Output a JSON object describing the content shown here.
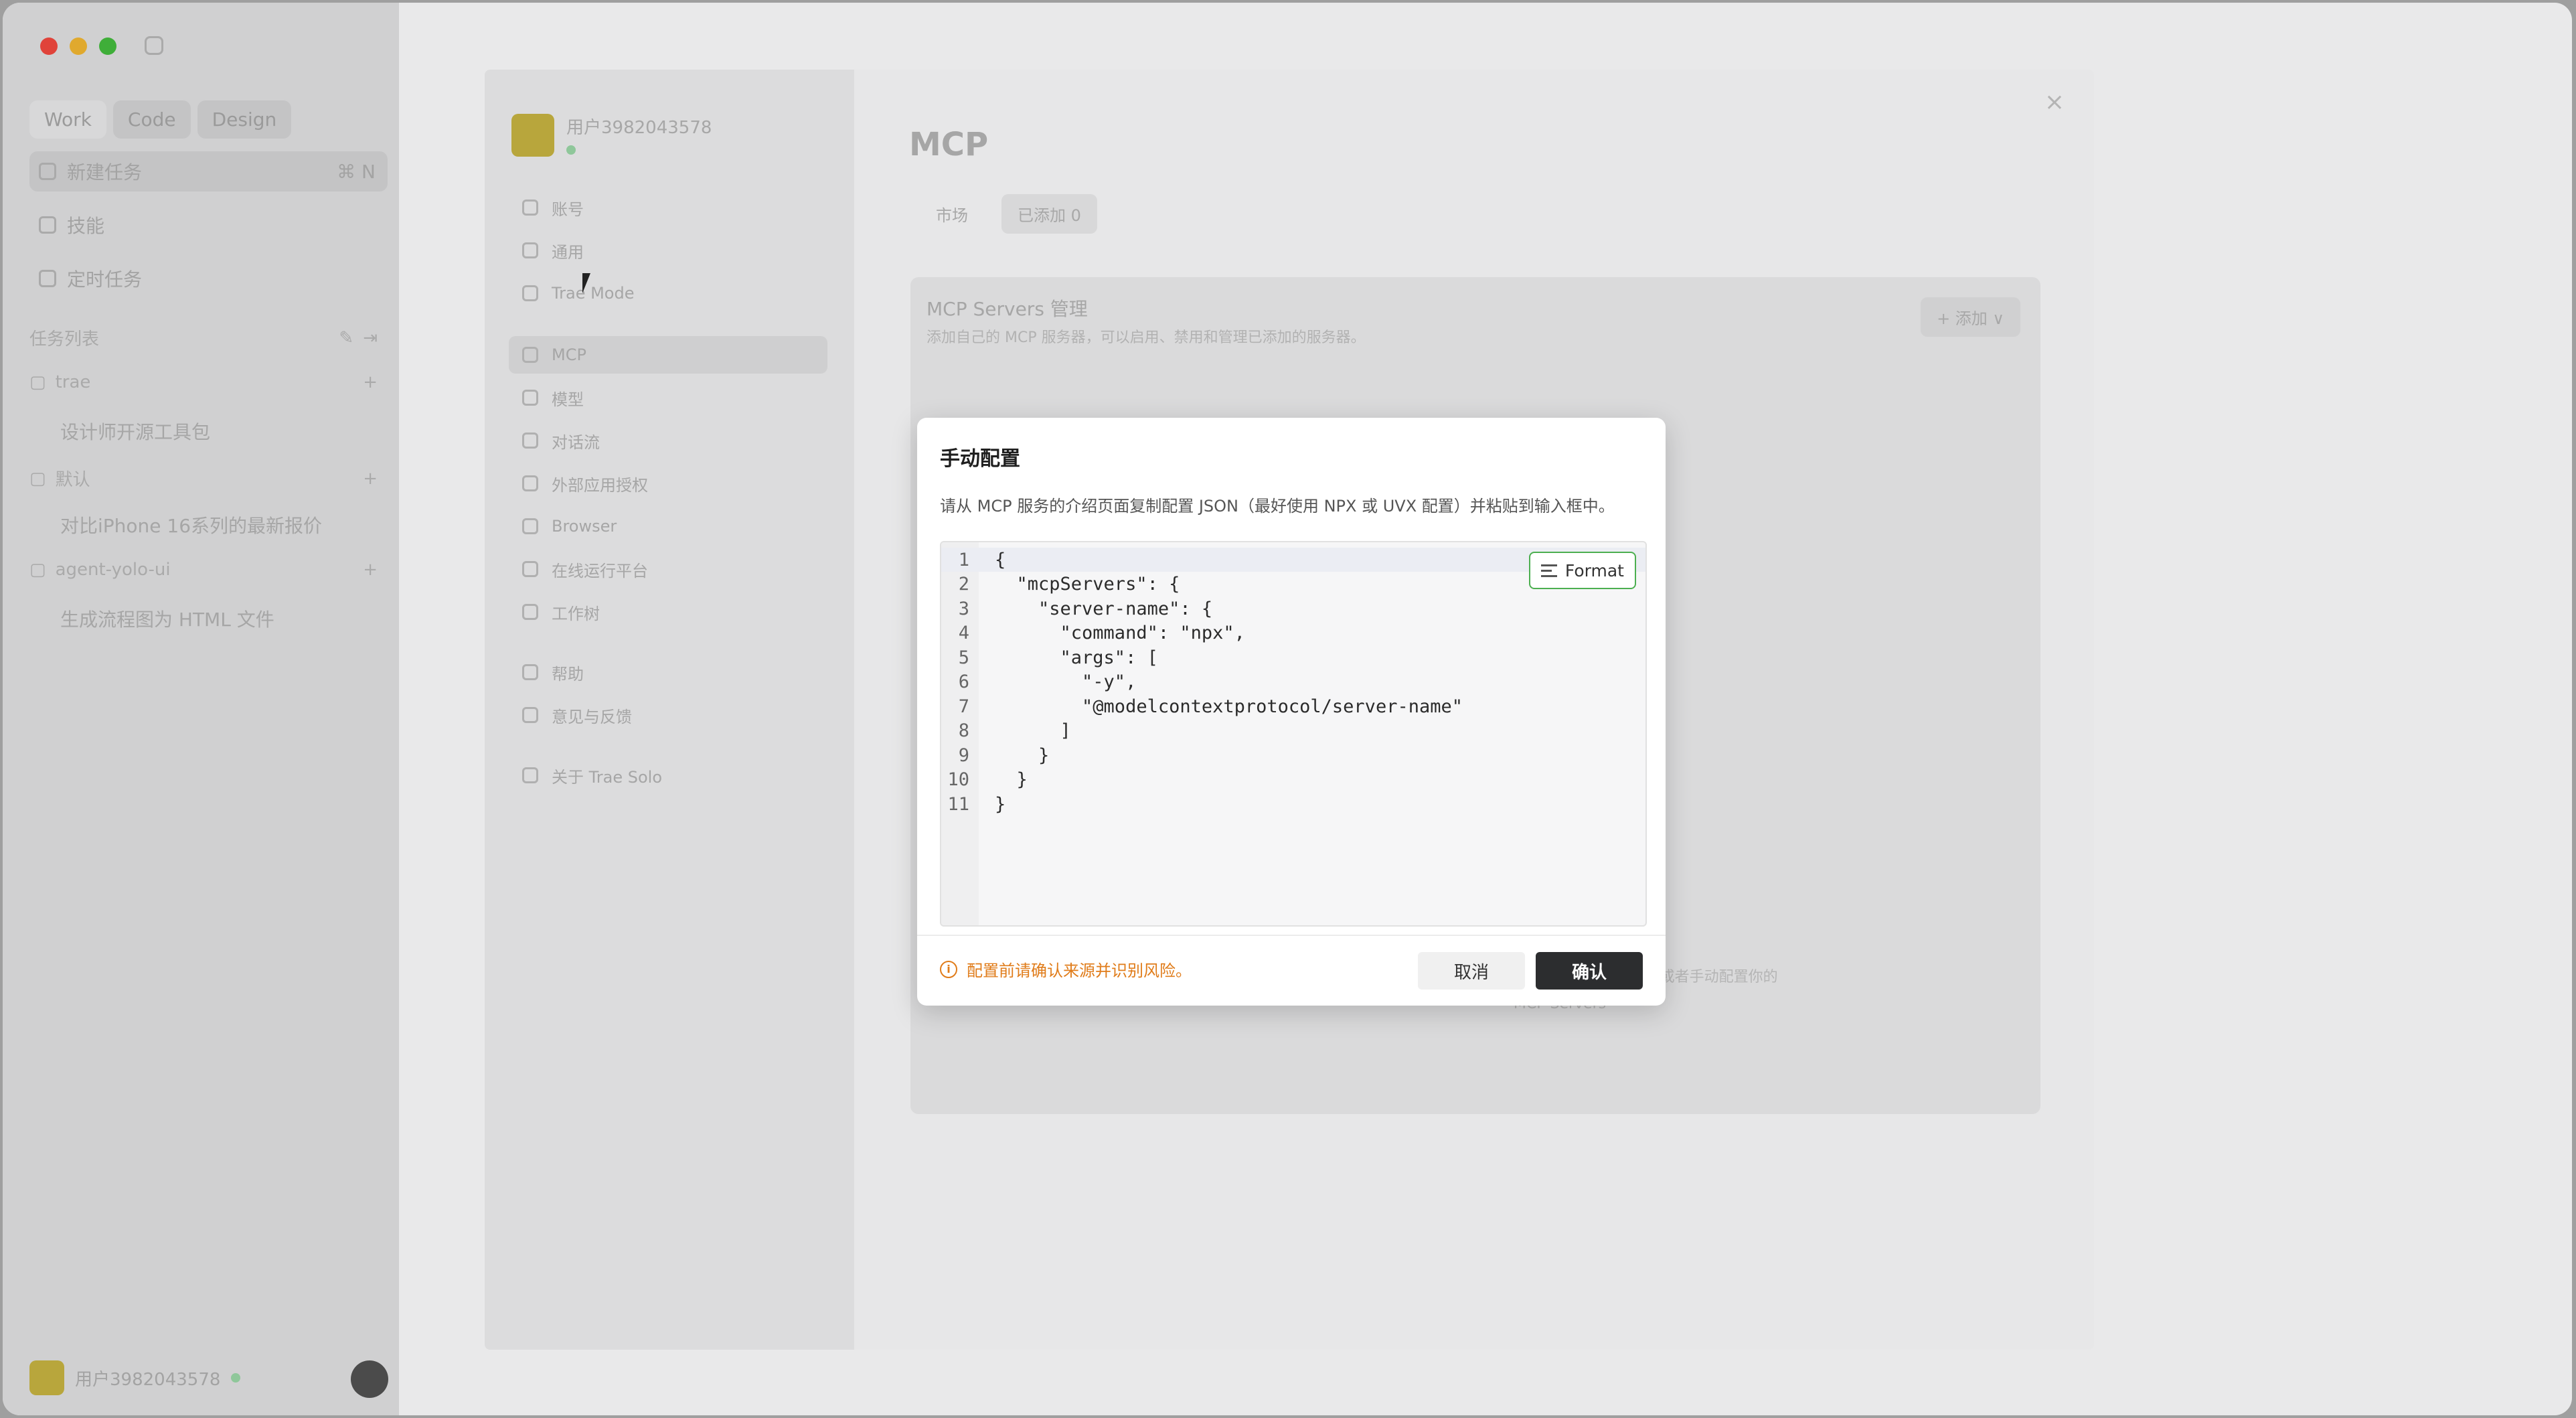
{
  "app_sidebar": {
    "mode_tabs": [
      "Work",
      "Code",
      "Design"
    ],
    "rows": [
      {
        "label": "新建任务",
        "shortcut": "⌘ N"
      },
      {
        "label": "技能"
      },
      {
        "label": "定时任务"
      }
    ],
    "section_title": "任务列表",
    "groups": [
      {
        "label": "trae",
        "items": [
          "设计师开源工具包"
        ]
      },
      {
        "label": "默认",
        "items": [
          "对比iPhone 16系列的最新报价"
        ]
      },
      {
        "label": "agent-yolo-ui",
        "items": [
          "生成流程图为 HTML 文件"
        ]
      }
    ],
    "user_name": "用户3982043578"
  },
  "settings": {
    "user_name": "用户3982043578",
    "nav_group1": [
      "账号",
      "通用",
      "Trae Mode"
    ],
    "nav_group2": [
      "MCP",
      "模型",
      "对话流",
      "外部应用授权",
      "Browser",
      "在线运行平台",
      "工作树"
    ],
    "nav_group3": [
      "帮助",
      "意见与反馈"
    ],
    "nav_about": "关于 Trae Solo",
    "title": "MCP",
    "tabs": [
      "市场",
      "已添加 0"
    ],
    "box_title": "MCP Servers 管理",
    "box_subtitle": "添加自己的 MCP 服务器，可以启用、禁用和管理已添加的服务器。",
    "add_button": "+ 添加 ∨",
    "empty_text": "暂无已添加的 MCP Servers，可以从市场中添加或者手动配置你的 MCP Servers"
  },
  "dialog": {
    "title": "手动配置",
    "description": "请从 MCP 服务的介绍页面复制配置 JSON（最好使用 NPX 或 UVX 配置）并粘贴到输入框中。",
    "format_label": "Format",
    "code_lines": [
      "{",
      "  \"mcpServers\": {",
      "    \"server-name\": {",
      "      \"command\": \"npx\",",
      "      \"args\": [",
      "        \"-y\",",
      "        \"@modelcontextprotocol/server-name\"",
      "      ]",
      "    }",
      "  }",
      "}"
    ],
    "line_numbers": [
      "1",
      "2",
      "3",
      "4",
      "5",
      "6",
      "7",
      "8",
      "9",
      "10",
      "11"
    ],
    "warning": "配置前请确认来源并识别风险。",
    "cancel_label": "取消",
    "confirm_label": "确认"
  },
  "colors": {
    "accent_green": "#4caf50",
    "warning_orange": "#e07c1a",
    "confirm_dark": "#2c2d2f"
  }
}
